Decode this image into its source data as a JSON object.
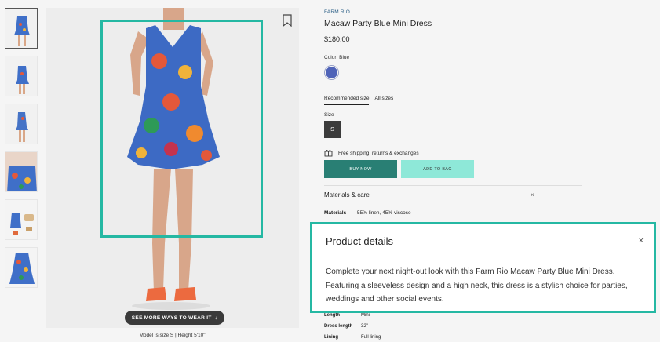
{
  "product": {
    "brand": "FARM RIO",
    "title": "Macaw Party Blue Mini Dress",
    "price": "$180.00",
    "color_label": "Color: Blue",
    "size_tabs": [
      "Recommended size",
      "All sizes"
    ],
    "size_label": "Size",
    "selected_size": "S",
    "shipping": "Free shipping, returns & exchanges",
    "buy_now": "BUY NOW",
    "add_to_bag": "ADD TO BAG"
  },
  "media": {
    "see_more": "SEE MORE WAYS TO WEAR IT",
    "see_more_arrow": "↓",
    "model_info": "Model is size S | Height 5'10\""
  },
  "materials": {
    "heading": "Materials & care",
    "close": "×",
    "row_key": "Materials",
    "row_value": "55% linen, 45% viscose"
  },
  "details": {
    "heading": "Product details",
    "close": "×",
    "text": "Complete your next night-out look with this Farm Rio Macaw Party Blue Mini Dress. Featuring a sleeveless design and a high neck, this dress is a stylish choice for parties, weddings and other social events."
  },
  "specs": [
    {
      "k": "Length",
      "v": "Mini"
    },
    {
      "k": "Dress length",
      "v": "32\""
    },
    {
      "k": "Lining",
      "v": "Full lining"
    }
  ],
  "colors": {
    "accent_highlight": "#25b8a3",
    "buy_now_bg": "#297f74",
    "add_to_bag_bg": "#8ee8d8",
    "brand_text": "#2b5f86",
    "swatch": "#4f63b8"
  }
}
